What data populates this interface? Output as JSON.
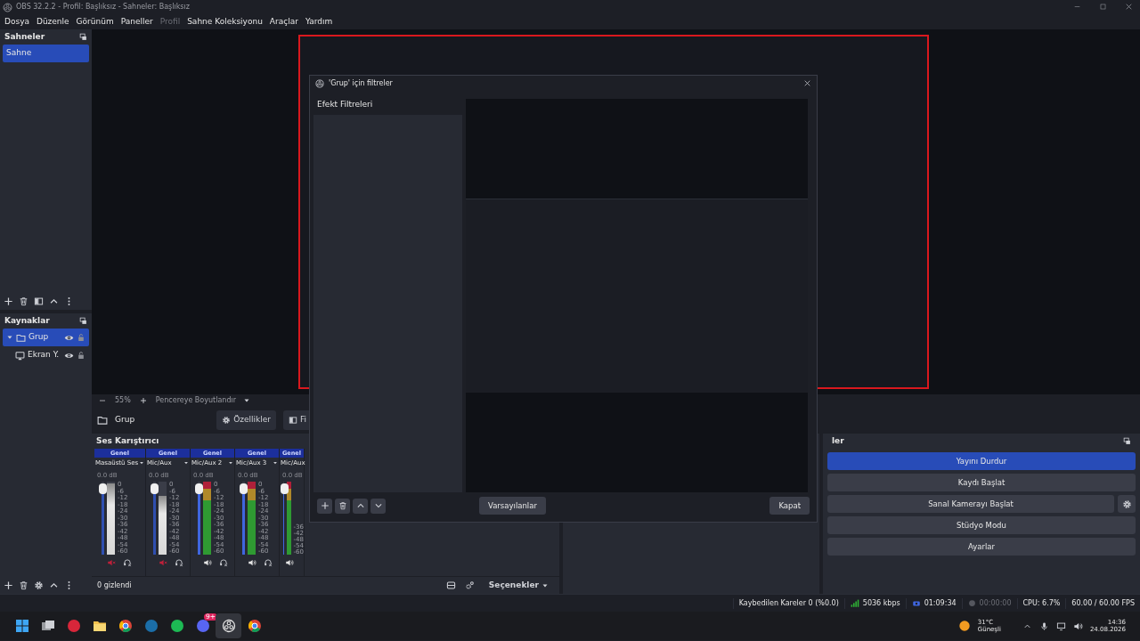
{
  "window": {
    "title": "OBS 32.2.2 - Profil: Başlıksız - Sahneler: Başlıksız"
  },
  "menu": [
    {
      "label": "Dosya",
      "disabled": false
    },
    {
      "label": "Düzenle",
      "disabled": false
    },
    {
      "label": "Görünüm",
      "disabled": false
    },
    {
      "label": "Paneller",
      "disabled": false
    },
    {
      "label": "Profil",
      "disabled": true
    },
    {
      "label": "Sahne Koleksiyonu",
      "disabled": false
    },
    {
      "label": "Araçlar",
      "disabled": false
    },
    {
      "label": "Yardım",
      "disabled": false
    }
  ],
  "scenes_dock": {
    "title": "Sahneler",
    "items": [
      {
        "label": "Sahne",
        "selected": true
      }
    ]
  },
  "sources_dock": {
    "title": "Kaynaklar",
    "items": [
      {
        "label": "Grup",
        "kind": "group",
        "selected": true,
        "expanded": true,
        "children": [
          {
            "label": "Ekran Y.",
            "kind": "display",
            "selected": false
          }
        ]
      }
    ]
  },
  "preview": {
    "zoom": "55%",
    "fit": "Pencereye Boyutlandır"
  },
  "source_toolbar": {
    "source": "Grup",
    "buttons": [
      {
        "label": "Özellikler",
        "kind": "properties"
      },
      {
        "label": "Fi",
        "kind": "filters"
      }
    ]
  },
  "mixer": {
    "title": "Ses Karıştırıcı",
    "hidden_count": "0 gizlendi",
    "options": "Seçenekler",
    "channels": [
      {
        "track": "Genel",
        "name": "Masaüstü Ses",
        "volume": "0.0 dB",
        "muted": true,
        "fader": {
          "level": 0.95
        },
        "meter": {
          "level": 0.98
        },
        "scale": [
          "0",
          "-6",
          "-12",
          "-18",
          "-24",
          "-30",
          "-36",
          "-42",
          "-48",
          "-54",
          "-60"
        ]
      },
      {
        "track": "Genel",
        "name": "Mic/Aux",
        "volume": "0.0 dB",
        "muted": true,
        "fader": {
          "level": 0.95
        },
        "meter": {
          "level": 0.8
        },
        "scale": [
          "0",
          "-6",
          "-12",
          "-18",
          "-24",
          "-30",
          "-36",
          "-42",
          "-48",
          "-54",
          "-60"
        ]
      },
      {
        "track": "Genel",
        "name": "Mic/Aux 2",
        "volume": "0.0 dB",
        "muted": false,
        "fader": {
          "level": 0.95
        },
        "meter": {
          "level": 1
        },
        "scale": [
          "0",
          "-6",
          "-12",
          "-18",
          "-24",
          "-30",
          "-36",
          "-42",
          "-48",
          "-54",
          "-60"
        ]
      },
      {
        "track": "Genel",
        "name": "Mic/Aux 3",
        "volume": "0.0 dB",
        "muted": false,
        "fader": {
          "level": 0.95
        },
        "meter": {
          "level": 1
        },
        "scale": [
          "0",
          "-6",
          "-12",
          "-18",
          "-24",
          "-30",
          "-36",
          "-42",
          "-48",
          "-54",
          "-60"
        ]
      },
      {
        "track": "Genel",
        "name": "Mic/Aux",
        "volume": "0.0 dB",
        "muted": false,
        "fader": {
          "level": 0.95
        },
        "meter": {
          "level": 1
        },
        "scale": [
          "-36",
          "-42",
          "-48",
          "-54",
          "-60"
        ]
      }
    ]
  },
  "filters_dialog": {
    "title": "'Grup' için filtreler",
    "section": "Efekt Filtreleri",
    "defaults_button": "Varsayılanlar",
    "close_button": "Kapat"
  },
  "controls": {
    "title": "ler",
    "buttons": [
      {
        "label": "Yayını Durdur",
        "active": true,
        "settings": false
      },
      {
        "label": "Kaydı Başlat",
        "active": false,
        "settings": false
      },
      {
        "label": "Sanal Kamerayı Başlat",
        "active": false,
        "settings": true
      },
      {
        "label": "Stüdyo Modu",
        "active": false,
        "settings": false
      },
      {
        "label": "Ayarlar",
        "active": false,
        "settings": false
      }
    ]
  },
  "status_bar": {
    "dropped": "Kaybedilen Kareler 0 (%0.0)",
    "bitrate": "5036 kbps",
    "stream_time": "01:09:34",
    "record_time": "00:00:00",
    "cpu": "CPU: 6.7%",
    "fps": "60.00 / 60.00 FPS"
  },
  "taskbar": {
    "apps": [
      {
        "kind": "start",
        "selected": false
      },
      {
        "kind": "taskview",
        "selected": false
      },
      {
        "kind": "red",
        "selected": false
      },
      {
        "kind": "folder",
        "selected": false
      },
      {
        "kind": "browser",
        "selected": false
      },
      {
        "kind": "steam",
        "selected": false
      },
      {
        "kind": "music",
        "selected": false
      },
      {
        "kind": "chat",
        "selected": false,
        "badge": "9+"
      },
      {
        "kind": "obs",
        "selected": true
      },
      {
        "kind": "browser",
        "selected": false
      }
    ],
    "weather": {
      "temp": "31°C",
      "condition": "Güneşli"
    },
    "clock": {
      "time": "14:36",
      "date": "24.08.2026"
    }
  }
}
